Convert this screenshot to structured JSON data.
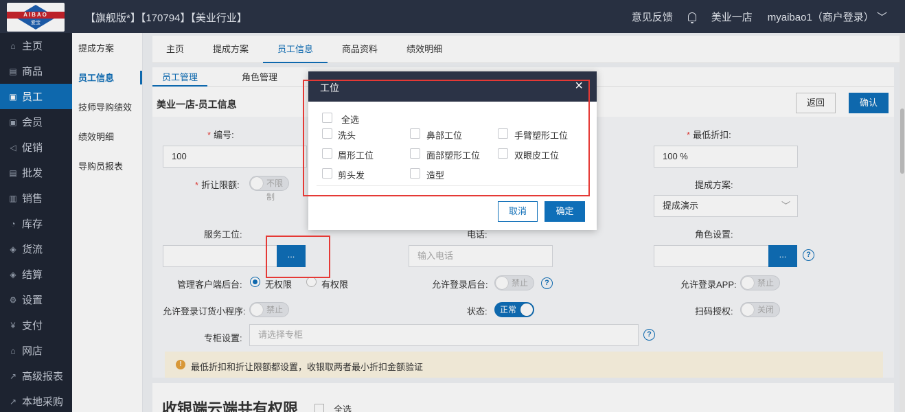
{
  "header": {
    "logo_text": "AIBAO",
    "logo_sub": "爱宝",
    "title": "【旗舰版*】【170794】【美业行业】",
    "feedback": "意见反馈",
    "store": "美业一店",
    "user": "myaibao1（商户登录）"
  },
  "sidebar": {
    "items": [
      {
        "label": "主页",
        "icon": "home-icon"
      },
      {
        "label": "商品",
        "icon": "goods-icon"
      },
      {
        "label": "员工",
        "icon": "staff-icon"
      },
      {
        "label": "会员",
        "icon": "member-icon"
      },
      {
        "label": "促销",
        "icon": "promo-icon"
      },
      {
        "label": "批发",
        "icon": "wholesale-icon"
      },
      {
        "label": "销售",
        "icon": "sales-icon"
      },
      {
        "label": "库存",
        "icon": "stock-icon"
      },
      {
        "label": "货流",
        "icon": "flow-icon"
      },
      {
        "label": "结算",
        "icon": "settle-icon"
      },
      {
        "label": "设置",
        "icon": "gear-icon"
      },
      {
        "label": "支付",
        "icon": "pay-icon"
      },
      {
        "label": "网店",
        "icon": "shop-icon"
      },
      {
        "label": "高级报表",
        "icon": "report-icon"
      },
      {
        "label": "本地采购",
        "icon": "purchase-icon"
      }
    ],
    "active_index": 2
  },
  "submenu": {
    "items": [
      "提成方案",
      "员工信息",
      "技师导购绩效",
      "绩效明细",
      "导购员报表"
    ],
    "active_index": 1
  },
  "main_tabs": [
    "主页",
    "提成方案",
    "员工信息",
    "商品资料",
    "绩效明细"
  ],
  "sub_tabs": [
    "员工管理",
    "角色管理"
  ],
  "panel": {
    "title": "美业一店-员工信息",
    "back_label": "返回",
    "confirm_label": "确认"
  },
  "form": {
    "code_label": "编号:",
    "code_value": "100",
    "min_discount_label": "最低折扣:",
    "min_discount_value": "100 %",
    "discount_limit_label": "折让限额:",
    "discount_limit_toggle": "不限制",
    "commission_label": "提成方案:",
    "commission_value": "提成演示",
    "service_label": "服务工位:",
    "dots": "...",
    "phone_label": "电话:",
    "phone_placeholder": "输入电话",
    "role_label": "角色设置:",
    "backend_label": "管理客户端后台:",
    "radio_none": "无权限",
    "radio_has": "有权限",
    "login_backend_label": "允许登录后台:",
    "login_backend_toggle": "禁止",
    "login_app_label": "允许登录APP:",
    "login_app_toggle": "禁止",
    "order_mini_label": "允许登录订货小程序:",
    "order_mini_toggle": "禁止",
    "status_label": "状态:",
    "status_toggle": "正常",
    "scan_label": "扫码授权:",
    "scan_toggle": "关闭",
    "counter_label": "专柜设置:",
    "counter_placeholder": "请选择专柜",
    "notice": "最低折扣和折让限额都设置，收银取两者最小折扣金额验证"
  },
  "bottom": {
    "title": "收银端云端共有权限",
    "select_all": "全选"
  },
  "modal": {
    "title": "工位",
    "close": "×",
    "select_all": "全选",
    "options": [
      "洗头",
      "鼻部工位",
      "手臂塑形工位",
      "眉形工位",
      "面部塑形工位",
      "双眼皮工位",
      "剪头发",
      "造型"
    ],
    "cancel_label": "取消",
    "confirm_label": "确定"
  },
  "colors": {
    "accent": "#0f6fb8",
    "header_bg": "#2b3346",
    "highlight": "#e53935"
  }
}
